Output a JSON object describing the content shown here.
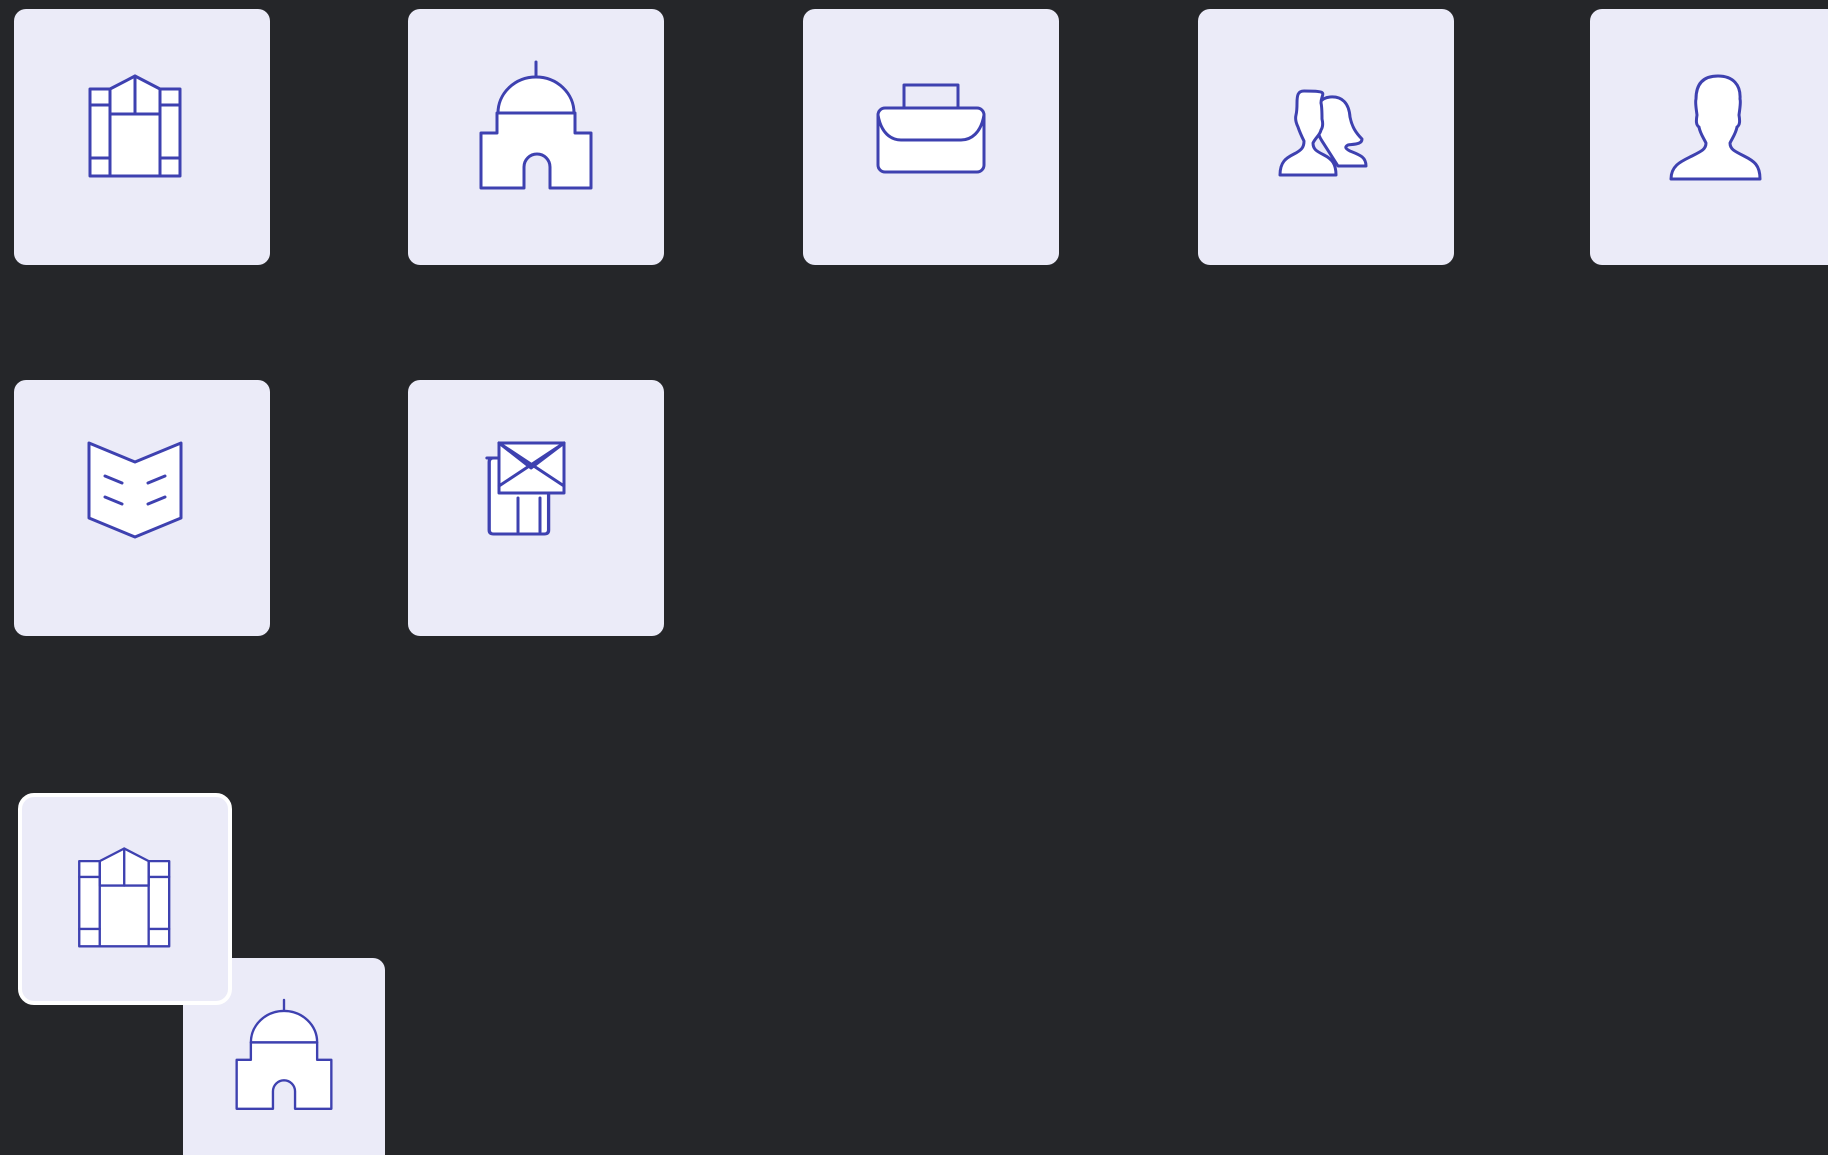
{
  "theme": {
    "background": "#252629",
    "tile_background": "#ebebf8",
    "icon_stroke": "#3e41b0",
    "icon_fill": "#ffffff",
    "drag_outline": "#ffffff"
  },
  "icon_grid": {
    "tiles": [
      {
        "icon": "building-columns-icon"
      },
      {
        "icon": "domed-building-icon"
      },
      {
        "icon": "briefcase-icon"
      },
      {
        "icon": "user-group-icon"
      },
      {
        "icon": "user-icon"
      },
      {
        "icon": "open-book-icon"
      },
      {
        "icon": "mail-building-icon"
      }
    ]
  },
  "drag_preview": {
    "items": [
      {
        "icon": "building-columns-icon"
      },
      {
        "icon": "domed-building-icon"
      }
    ]
  }
}
